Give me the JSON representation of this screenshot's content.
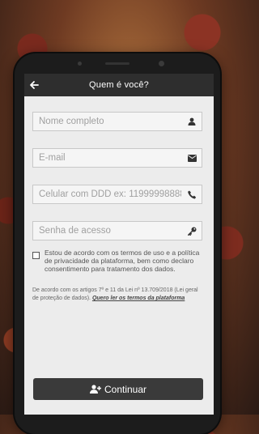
{
  "header": {
    "title": "Quem é você?",
    "back_icon": "arrow-left-icon"
  },
  "form": {
    "name": {
      "placeholder": "Nome completo",
      "icon": "user-icon"
    },
    "email": {
      "placeholder": "E-mail",
      "icon": "envelope-icon"
    },
    "phone": {
      "placeholder": "Celular com DDD ex: 11999998888",
      "icon": "phone-icon"
    },
    "password": {
      "placeholder": "Senha de acesso",
      "icon": "key-icon"
    }
  },
  "consent": {
    "checked": false,
    "text": "Estou de acordo com os termos de uso e a política de privacidade da plataforma, bem como declaro consentimento para tratamento dos dados."
  },
  "legal": {
    "text": "De acordo com os artigos 7º e 11 da Lei nº 13.709/2018 (Lei geral de proteção de dados).",
    "link": "Quero ler os termos da plataforma"
  },
  "submit": {
    "label": "Continuar",
    "icon": "user-plus-icon"
  },
  "colors": {
    "header_bg": "#2e2e2e",
    "screen_bg": "#ececec",
    "button_bg": "#3a3a3a"
  }
}
